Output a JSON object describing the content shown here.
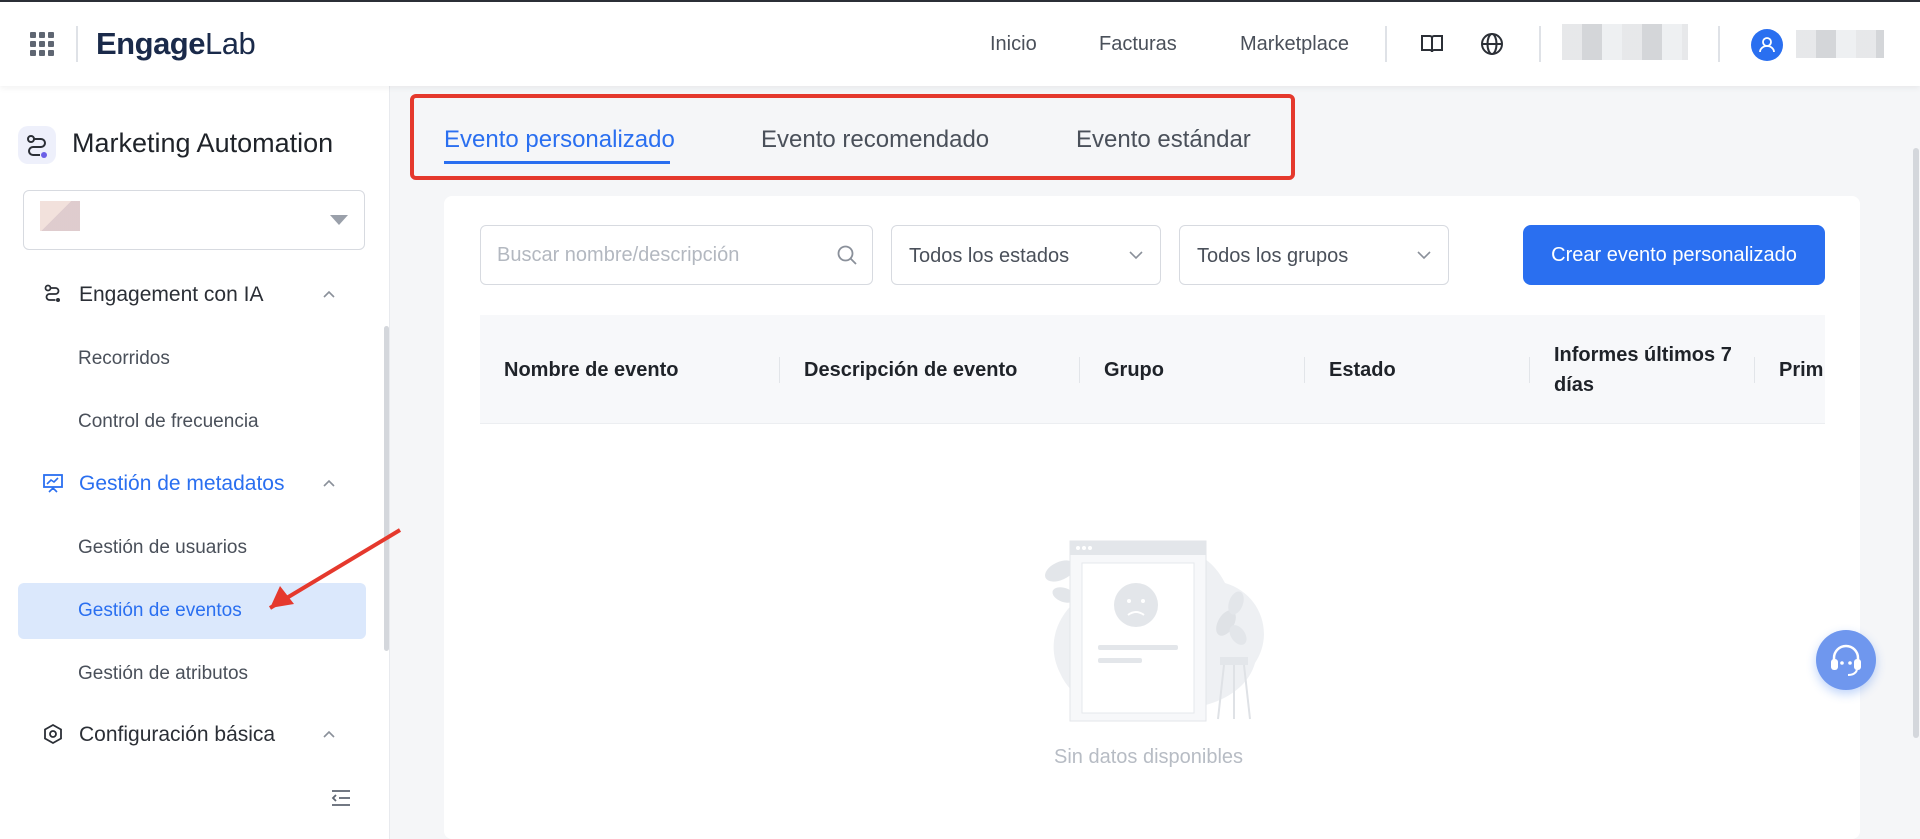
{
  "topbar": {
    "brand_prefix": "Eng",
    "brand_mid": "age",
    "brand_suffix": "Lab",
    "nav": [
      "Inicio",
      "Facturas",
      "Marketplace"
    ]
  },
  "sidebar": {
    "title": "Marketing Automation",
    "groups": [
      {
        "label": "Engagement con IA",
        "items": [
          "Recorridos",
          "Control de frecuencia"
        ]
      },
      {
        "label": "Gestión de metadatos",
        "items": [
          "Gestión de usuarios",
          "Gestión de eventos",
          "Gestión de atributos"
        ]
      },
      {
        "label": "Configuración básica",
        "items": []
      }
    ],
    "selected_item": "Gestión de eventos"
  },
  "tabs": [
    {
      "label": "Evento personalizado",
      "active": true
    },
    {
      "label": "Evento recomendado",
      "active": false
    },
    {
      "label": "Evento estándar",
      "active": false
    }
  ],
  "filters": {
    "search_placeholder": "Buscar nombre/descripción",
    "status": "Todos los estados",
    "group": "Todos los grupos"
  },
  "create_button": "Crear evento personalizado",
  "table": {
    "columns": [
      "Nombre de evento",
      "Descripción de evento",
      "Grupo",
      "Estado",
      "Informes últimos 7 días",
      "Prim"
    ],
    "rows": []
  },
  "empty_text": "Sin datos disponibles",
  "colors": {
    "accent": "#2a6ff0",
    "annotation": "#e5392d"
  },
  "icons": [
    "apps-grid-icon",
    "book-icon",
    "globe-icon",
    "user-icon",
    "search-icon",
    "chevron-down-icon",
    "chevron-up-icon",
    "support-icon"
  ]
}
